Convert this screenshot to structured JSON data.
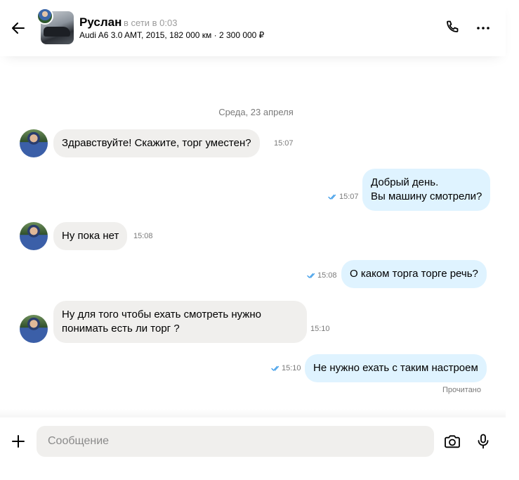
{
  "header": {
    "name": "Руслан",
    "status": "в сети в 0:03",
    "subtitle": "Audi A6 3.0 AMT, 2015, 182 000 км · 2 300 000 ₽"
  },
  "chat": {
    "date": "Среда, 23 апреля",
    "messages": [
      {
        "direction": "in",
        "text": "Здравствуйте! Скажите, торг уместен?",
        "time": "15:07"
      },
      {
        "direction": "out",
        "lines": [
          "Добрый день.",
          "Вы машину смотрели?"
        ],
        "time": "15:07"
      },
      {
        "direction": "in",
        "text": "Ну пока нет",
        "time": "15:08"
      },
      {
        "direction": "out",
        "text": "О каком торга торге речь?",
        "time": "15:08"
      },
      {
        "direction": "in",
        "lines": [
          "Ну для того чтобы ехать смотреть нужно",
          "понимать есть ли торг ?"
        ],
        "time": "15:10"
      },
      {
        "direction": "out",
        "text": "Не нужно ехать с таким настроем",
        "time": "15:10"
      }
    ],
    "read_status": "Прочитано"
  },
  "composer": {
    "placeholder": "Сообщение"
  },
  "icons": {
    "back": "arrow-left-icon",
    "call": "phone-icon",
    "more": "dots-horizontal-icon",
    "add": "plus-icon",
    "camera": "camera-icon",
    "mic": "microphone-icon",
    "read": "double-check-icon"
  },
  "colors": {
    "incoming_bubble": "#f0efed",
    "outgoing_bubble": "#dff3ff",
    "read_tick": "#3b9be8"
  }
}
